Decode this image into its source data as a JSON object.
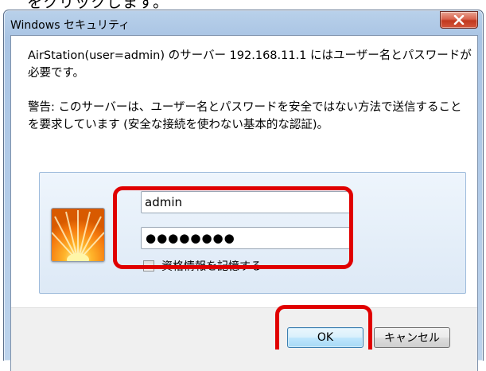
{
  "top_text": "をクリックします。",
  "dialog": {
    "title": "Windows セキュリティ",
    "close_label": "✕",
    "message1": "AirStation(user=admin) のサーバー 192.168.11.1 にはユーザー名とパスワードが必要です。",
    "message2": "警告: このサーバーは、ユーザー名とパスワードを安全ではない方法で送信することを要求しています (安全な接続を使わない基本的な認証)。",
    "username": "admin",
    "password_mask": "●●●●●●●●",
    "remember_label": "資格情報を記憶する",
    "remember_checked": false,
    "ok_label": "OK",
    "cancel_label": "キャンセル"
  },
  "colors": {
    "highlight": "#e00000",
    "titlebar": "#b9d1ea",
    "close_button": "#c1391f"
  },
  "icons": {
    "close": "close-icon",
    "user_tile": "flower-user-tile-icon"
  }
}
